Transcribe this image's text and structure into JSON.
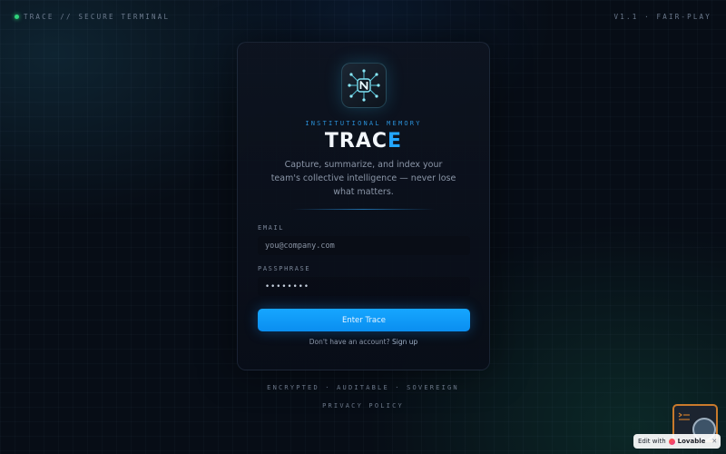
{
  "topbar": {
    "left_text": "TRACE // SECURE TERMINAL",
    "right_text": "V1.1 · FAIR-PLAY"
  },
  "card": {
    "eyebrow": "INSTITUTIONAL MEMORY",
    "brand_main": "TRAC",
    "brand_accent": "E",
    "tagline": "Capture, summarize, and index your team's collective intelligence — never lose what matters.",
    "email": {
      "label": "EMAIL",
      "placeholder": "you@company.com",
      "value": ""
    },
    "password": {
      "label": "PASSPHRASE",
      "value": "••••••••"
    },
    "submit_label": "Enter Trace",
    "signup_prompt": "Don't have an account?",
    "signup_link": "Sign up"
  },
  "footer": {
    "tags": "ENCRYPTED · AUDITABLE · SOVEREIGN",
    "privacy": "PRIVACY POLICY"
  },
  "badge": {
    "prefix": "Edit with",
    "name": "Lovable",
    "close": "✕"
  },
  "colors": {
    "accent": "#23a6ff",
    "button": "#12a0ff",
    "status": "#2fd27a",
    "background": "#070d16"
  },
  "icons": [
    "status-dot-icon",
    "trace-logo-icon",
    "heart-icon",
    "close-icon"
  ]
}
